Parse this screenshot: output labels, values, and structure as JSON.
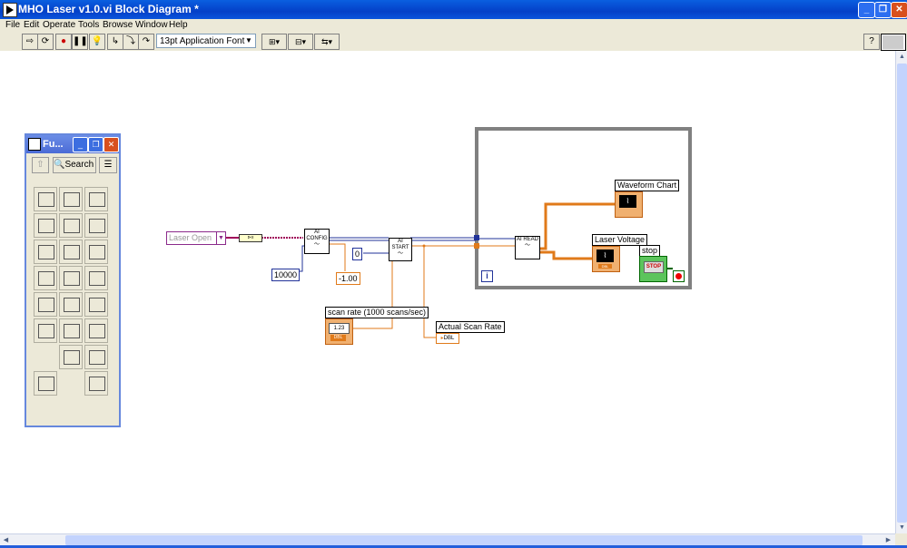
{
  "window": {
    "title": "MHO Laser v1.0.vi Block Diagram *"
  },
  "menu": [
    "File",
    "Edit",
    "Operate",
    "Tools",
    "Browse",
    "Window",
    "Help"
  ],
  "toolbar": {
    "font": "13pt Application Font"
  },
  "palette": {
    "title": "Fu...",
    "search": "Search"
  },
  "diagram": {
    "enum_value": "Laser Open",
    "const_10000": "10000",
    "const_0": "0",
    "const_neg1": "-1.00",
    "ai_config": "AI CONFIG",
    "ai_start": "AI START",
    "ai_read": "AI READ",
    "scan_rate_label": "scan rate (1000 scans/sec)",
    "actual_scan_label": "Actual Scan Rate",
    "waveform_label": "Waveform Chart",
    "laser_voltage_label": "Laser Voltage",
    "stop_label": "stop",
    "stop_button": "STOP",
    "iter": "i",
    "dbl": "DBL"
  }
}
